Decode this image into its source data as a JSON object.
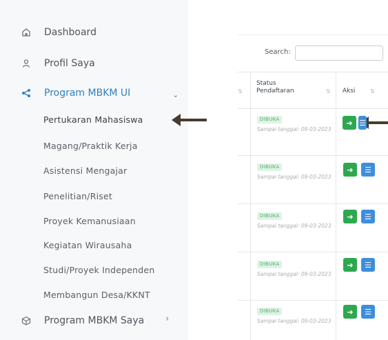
{
  "sidebar": {
    "dashboard": "Dashboard",
    "profil": "Profil Saya",
    "program_ui": "Program MBKM UI",
    "sub_items": [
      "Pertukaran Mahasiswa",
      "Magang/Praktik Kerja",
      "Asistensi Mengajar",
      "Penelitian/Riset",
      "Proyek Kemanusiaan",
      "Kegiatan Wirausaha",
      "Studi/Proyek Independen",
      "Membangun Desa/KKNT"
    ],
    "program_saya": "Program MBKM Saya"
  },
  "search": {
    "label": "Search:",
    "value": ""
  },
  "table": {
    "col_status_1": "Status",
    "col_status_2": "Pendaftaran",
    "col_aksi": "Aksi",
    "rows": [
      {
        "badge": "DIBUKA",
        "note": "Sampai tanggal: 09-03-2023"
      },
      {
        "badge": "DIBUKA",
        "note": "Sampai tanggal: 09-03-2023"
      },
      {
        "badge": "DIBUKA",
        "note": "Sampai tanggal: 09-03-2023"
      },
      {
        "badge": "DIBUKA",
        "note": "Sampai tanggal: 09-03-2023"
      },
      {
        "badge": "DIBUKA",
        "note": "Sampai tanggal: 09-03-2023"
      }
    ]
  },
  "icons": {
    "dashboard": "home-icon",
    "profil": "user-icon",
    "program_ui": "share-icon",
    "program_saya": "box-icon",
    "go": "arrow-right-icon",
    "list": "list-icon"
  },
  "colors": {
    "active": "#2f7fbf",
    "go_button": "#2ea84f",
    "list_button": "#3f8edc",
    "badge_bg": "#dff3e4",
    "badge_text": "#4caf6a"
  }
}
